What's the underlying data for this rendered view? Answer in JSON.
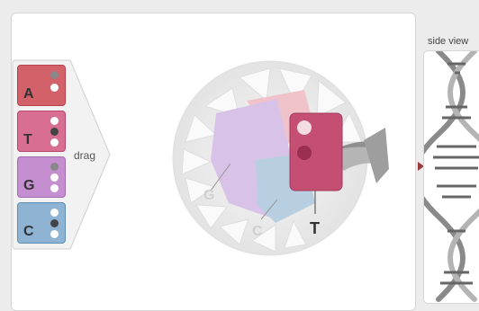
{
  "tray": {
    "drag_label": "drag",
    "tiles": [
      {
        "letter": "A",
        "color": "#d2616a",
        "border": "#b8414c",
        "dots": [
          "#888888",
          "#ffffff"
        ]
      },
      {
        "letter": "T",
        "color": "#d86f92",
        "border": "#b8466e",
        "dots": [
          "#ffffff",
          "#444444",
          "#ffffff"
        ]
      },
      {
        "letter": "G",
        "color": "#c58ed0",
        "border": "#a36bb0",
        "dots": [
          "#888888",
          "#ffffff",
          "#ffffff"
        ]
      },
      {
        "letter": "C",
        "color": "#8fb3d2",
        "border": "#5f8db3",
        "dots": [
          "#ffffff",
          "#444444",
          "#ffffff"
        ]
      }
    ]
  },
  "wheel": {
    "labels": {
      "g": "G",
      "c": "C",
      "t": "T"
    },
    "colors": {
      "purple": "#d9c2e8",
      "blue": "#b7cfe0",
      "pink": "#efc3c9",
      "t_piece": "#c54f72"
    }
  },
  "side_view": {
    "title": "side view"
  },
  "colors": {
    "arrow": "#9b3a3a",
    "panel_border": "#d6d6d6"
  }
}
